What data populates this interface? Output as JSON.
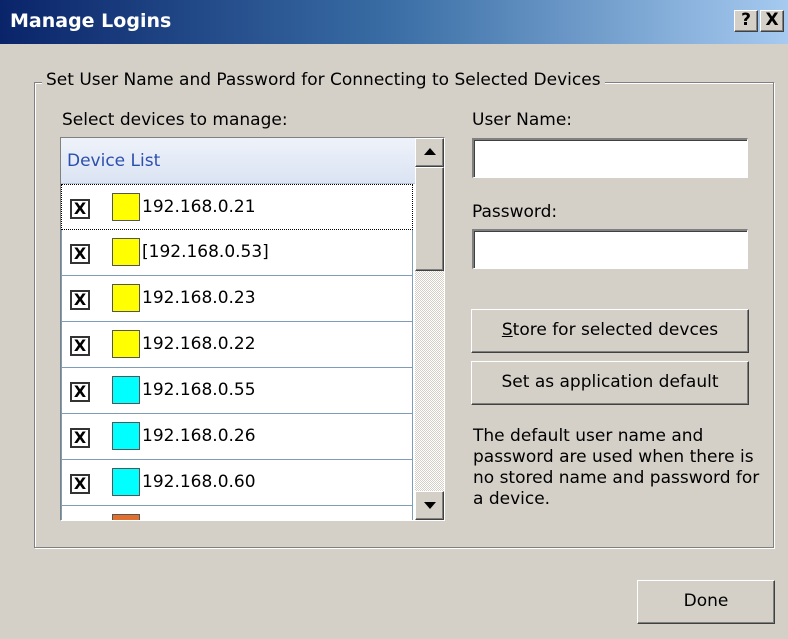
{
  "window": {
    "title": "Manage Logins",
    "help_label": "?",
    "close_label": "X"
  },
  "group": {
    "legend": "Set User Name and Password for Connecting to Selected Devices"
  },
  "devices": {
    "label": "Select devices to manage:",
    "header": "Device List",
    "items": [
      {
        "checked": "X",
        "color": "#ffff00",
        "address": "192.168.0.21",
        "selected": true
      },
      {
        "checked": "X",
        "color": "#ffff00",
        "address": "[192.168.0.53]",
        "selected": false
      },
      {
        "checked": "X",
        "color": "#ffff00",
        "address": "192.168.0.23",
        "selected": false
      },
      {
        "checked": "X",
        "color": "#ffff00",
        "address": "192.168.0.22",
        "selected": false
      },
      {
        "checked": "X",
        "color": "#00ffff",
        "address": "192.168.0.55",
        "selected": false
      },
      {
        "checked": "X",
        "color": "#00ffff",
        "address": "192.168.0.26",
        "selected": false
      },
      {
        "checked": "X",
        "color": "#00ffff",
        "address": "192.168.0.60",
        "selected": false
      },
      {
        "checked": "",
        "color": "#e07030",
        "address": "",
        "selected": false
      }
    ]
  },
  "form": {
    "username_label": "User Name:",
    "username_value": "",
    "password_label": "Password:",
    "password_value": ""
  },
  "buttons": {
    "store_underlined": "S",
    "store_rest": "tore for selected devces",
    "set_default": "Set as application default",
    "done": "Done"
  },
  "note": "The default user name and password are used when there is no stored name and password for a device."
}
